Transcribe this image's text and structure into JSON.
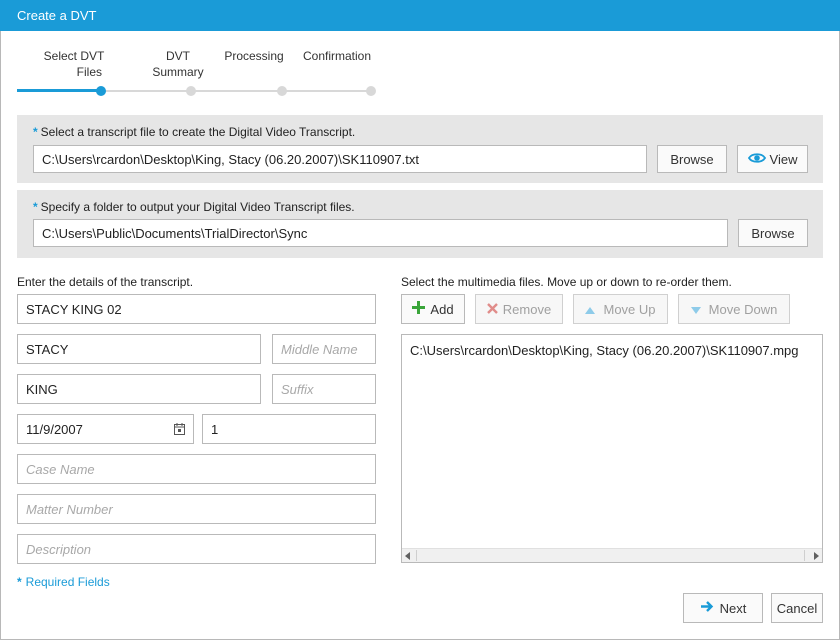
{
  "window": {
    "title": "Create a DVT"
  },
  "stepper": {
    "steps": [
      {
        "label_line1": "Select DVT",
        "label_line2": "Files"
      },
      {
        "label_line1": "DVT",
        "label_line2": "Summary"
      },
      {
        "label_line1": "Processing",
        "label_line2": ""
      },
      {
        "label_line1": "Confirmation",
        "label_line2": ""
      }
    ],
    "active_index": 0
  },
  "transcript_file": {
    "required_mark": "*",
    "label": "Select a transcript file to create the Digital Video Transcript.",
    "path": "C:\\Users\\rcardon\\Desktop\\King, Stacy (06.20.2007)\\SK110907.txt",
    "browse_label": "Browse",
    "view_label": "View"
  },
  "output_folder": {
    "required_mark": "*",
    "label": "Specify a folder to output your Digital Video Transcript files.",
    "path": "C:\\Users\\Public\\Documents\\TrialDirector\\Sync",
    "browse_label": "Browse"
  },
  "details": {
    "label": "Enter the details of the transcript.",
    "transcript_name": "STACY KING 02",
    "first_name": "STACY",
    "middle_name_placeholder": "Middle Name",
    "last_name": "KING",
    "suffix_placeholder": "Suffix",
    "date": "11/9/2007",
    "volume": "1",
    "case_name_placeholder": "Case Name",
    "matter_number_placeholder": "Matter Number",
    "description_placeholder": "Description"
  },
  "multimedia": {
    "label": "Select the multimedia files. Move up or down to re-order them.",
    "add_label": "Add",
    "remove_label": "Remove",
    "move_up_label": "Move Up",
    "move_down_label": "Move Down",
    "files": [
      "C:\\Users\\rcardon\\Desktop\\King, Stacy (06.20.2007)\\SK110907.mpg"
    ]
  },
  "footer": {
    "required_mark": "*",
    "required_note": "Required Fields",
    "next_label": "Next",
    "cancel_label": "Cancel"
  },
  "colors": {
    "accent": "#1a9bd7",
    "add_green": "#3aa53a",
    "remove_red": "#d9534f",
    "inactive_track": "#d8d8d8"
  }
}
